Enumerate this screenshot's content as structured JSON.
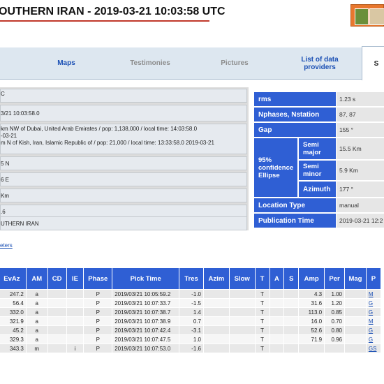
{
  "header": {
    "title": "OUTHERN IRAN - 2019-03-21 10:03:58 UTC"
  },
  "tabs": [
    {
      "label": "Maps"
    },
    {
      "label": "Testimonies"
    },
    {
      "label": "Pictures"
    },
    {
      "label": "List of data providers"
    },
    {
      "label": "S"
    }
  ],
  "event_info": [
    "C",
    "3/21 10:03:58.0",
    "km NW of Dubai, United Arab Emirates / pop: 1,138,000 / local time: 14:03:58.0",
    "-03-21",
    "m N of Kish, Iran, Islamic Republic of / pop: 21,000 / local time: 13:33:58.0 2019-03-21",
    "5 N",
    "6 E",
    "Km",
    ".6",
    "UTHERN IRAN"
  ],
  "solution": {
    "rms": {
      "label": "rms",
      "value": "1.23 s"
    },
    "nphases": {
      "label": "Nphases, Nstation",
      "value": "87, 87"
    },
    "gap": {
      "label": "Gap",
      "value": "155 °"
    },
    "ellipse_label": "95% confidence Ellipse",
    "semi_major": {
      "label": "Semi major",
      "value": "15.5 Km"
    },
    "semi_minor": {
      "label": "Semi minor",
      "value": "5.9 Km"
    },
    "azimuth": {
      "label": "Azimuth",
      "value": "177 °"
    },
    "location_type": {
      "label": "Location Type",
      "value": "manual"
    },
    "publication_time": {
      "label": "Publication Time",
      "value": "2019-03-21 12:2"
    }
  },
  "parameters_link": "eters",
  "picks_table": {
    "headers": [
      "EvAz",
      "AM",
      "CD",
      "IE",
      "Phase",
      "Pick Time",
      "Tres",
      "Azim",
      "Slow",
      "T",
      "A",
      "S",
      "Amp",
      "Per",
      "Mag",
      "P"
    ],
    "rows": [
      [
        "247.2",
        "a",
        "",
        "",
        "P",
        "2019/03/21 10:05:59.2",
        "-1.0",
        "",
        "",
        "T",
        "",
        "",
        "4.3",
        "1.00",
        "",
        "M"
      ],
      [
        "56.4",
        "a",
        "",
        "",
        "P",
        "2019/03/21 10:07:33.7",
        "-1.5",
        "",
        "",
        "T",
        "",
        "",
        "31.6",
        "1.20",
        "",
        "G"
      ],
      [
        "332.0",
        "a",
        "",
        "",
        "P",
        "2019/03/21 10:07:38.7",
        "1.4",
        "",
        "",
        "T",
        "",
        "",
        "113.0",
        "0.85",
        "",
        "G"
      ],
      [
        "321.9",
        "a",
        "",
        "",
        "P",
        "2019/03/21 10:07:38.9",
        "0.7",
        "",
        "",
        "T",
        "",
        "",
        "16.0",
        "0.70",
        "",
        "M"
      ],
      [
        "45.2",
        "a",
        "",
        "",
        "P",
        "2019/03/21 10:07:42.4",
        "-3.1",
        "",
        "",
        "T",
        "",
        "",
        "52.6",
        "0.80",
        "",
        "G"
      ],
      [
        "329.3",
        "a",
        "",
        "",
        "P",
        "2019/03/21 10:07:47.5",
        "1.0",
        "",
        "",
        "T",
        "",
        "",
        "71.9",
        "0.96",
        "",
        "G"
      ],
      [
        "343.3",
        "m",
        "",
        "i",
        "P",
        "2019/03/21 10:07:53.0",
        "-1.6",
        "",
        "",
        "T",
        "",
        "",
        "",
        "",
        "",
        "GS"
      ]
    ]
  },
  "colors": {
    "header_blue": "#2f5fd4",
    "link_blue": "#1a4fb4",
    "title_underline": "#c0392b",
    "logo_orange": "#e8772e"
  }
}
